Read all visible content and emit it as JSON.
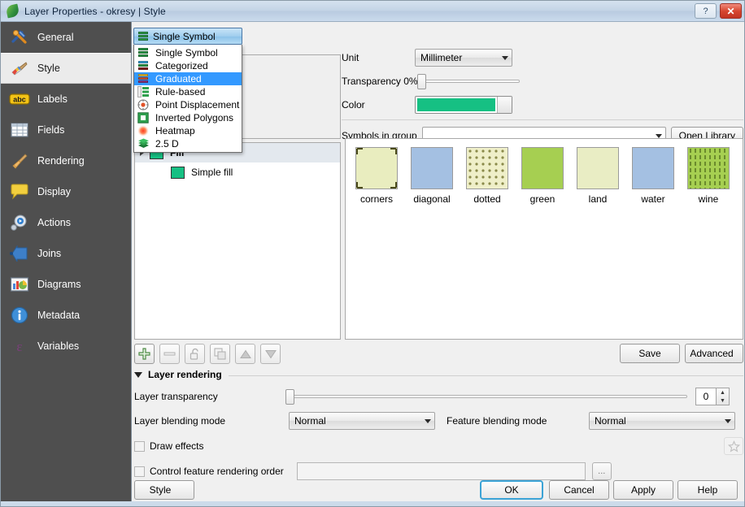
{
  "window": {
    "title": "Layer Properties - okresy | Style",
    "icon": "qgis-leaf-icon",
    "help_label": "?",
    "close_label": "✕"
  },
  "sidebar": {
    "items": [
      {
        "label": "General",
        "icon": "tools-icon",
        "selected": false
      },
      {
        "label": "Style",
        "icon": "paintbrush-icon",
        "selected": true
      },
      {
        "label": "Labels",
        "icon": "abc-label-icon",
        "selected": false
      },
      {
        "label": "Fields",
        "icon": "table-icon",
        "selected": false
      },
      {
        "label": "Rendering",
        "icon": "broom-icon",
        "selected": false
      },
      {
        "label": "Display",
        "icon": "speech-bubble-icon",
        "selected": false
      },
      {
        "label": "Actions",
        "icon": "gear-play-icon",
        "selected": false
      },
      {
        "label": "Joins",
        "icon": "join-arrow-icon",
        "selected": false
      },
      {
        "label": "Diagrams",
        "icon": "diagram-icon",
        "selected": false
      },
      {
        "label": "Metadata",
        "icon": "info-icon",
        "selected": false
      },
      {
        "label": "Variables",
        "icon": "epsilon-icon",
        "selected": false
      }
    ]
  },
  "renderer_dropdown": {
    "selected": "Single Symbol",
    "expanded": true,
    "options": [
      {
        "label": "Single Symbol",
        "icon": "single-symbol-icon",
        "highlighted": false
      },
      {
        "label": "Categorized",
        "icon": "categorized-icon",
        "highlighted": false
      },
      {
        "label": "Graduated",
        "icon": "graduated-icon",
        "highlighted": true
      },
      {
        "label": "Rule-based",
        "icon": "rule-based-icon",
        "highlighted": false
      },
      {
        "label": "Point Displacement",
        "icon": "point-displacement-icon",
        "highlighted": false
      },
      {
        "label": "Inverted Polygons",
        "icon": "inverted-polygons-icon",
        "highlighted": false
      },
      {
        "label": "Heatmap",
        "icon": "heatmap-icon",
        "highlighted": false
      },
      {
        "label": "2.5 D",
        "icon": "two-point-five-d-icon",
        "highlighted": false
      }
    ]
  },
  "symbol_preview": {
    "color": "#16c083"
  },
  "symbol_tree": {
    "parent": {
      "label": "Fill",
      "color": "#16c083",
      "selected": true
    },
    "child": {
      "label": "Simple fill",
      "color": "#16c083"
    }
  },
  "symbol_toolbar": {
    "buttons": [
      {
        "name": "add-symbol-layer",
        "icon": "plus-icon",
        "enabled": true
      },
      {
        "name": "remove-symbol-layer",
        "icon": "minus-icon",
        "enabled": false
      },
      {
        "name": "lock-symbol-layer",
        "icon": "lock-icon",
        "enabled": false
      },
      {
        "name": "duplicate-symbol-layer",
        "icon": "duplicate-icon",
        "enabled": false
      },
      {
        "name": "move-symbol-layer-up",
        "icon": "up-arrow-icon",
        "enabled": false
      },
      {
        "name": "move-symbol-layer-down",
        "icon": "down-arrow-icon",
        "enabled": false
      }
    ]
  },
  "symbol_properties": {
    "unit_label": "Unit",
    "unit_value": "Millimeter",
    "transparency_label": "Transparency 0%",
    "transparency_value": 0,
    "color_label": "Color",
    "color_value": "#16c083",
    "symbols_in_group_label": "Symbols in group",
    "symbols_in_group_value": "",
    "open_library_label": "Open Library"
  },
  "gallery": {
    "items": [
      {
        "label": "corners",
        "fill": "#e9edbf",
        "pattern": "corners"
      },
      {
        "label": "diagonal",
        "fill": "#a4c0e2",
        "pattern": "solid"
      },
      {
        "label": "dotted",
        "fill": "#efefc9",
        "pattern": "dots"
      },
      {
        "label": "green",
        "fill": "#a6cf51",
        "pattern": "solid"
      },
      {
        "label": "land",
        "fill": "#e9edc4",
        "pattern": "solid"
      },
      {
        "label": "water",
        "fill": "#a4c0e2",
        "pattern": "solid"
      },
      {
        "label": "wine",
        "fill": "#a6cf51",
        "pattern": "dashes"
      }
    ]
  },
  "style_actions": {
    "save_label": "Save",
    "advanced_label": "Advanced"
  },
  "layer_rendering": {
    "group_title": "Layer rendering",
    "transparency_label": "Layer transparency",
    "transparency_value": "0",
    "layer_blending_label": "Layer blending mode",
    "layer_blending_value": "Normal",
    "feature_blending_label": "Feature blending mode",
    "feature_blending_value": "Normal",
    "draw_effects_label": "Draw effects",
    "draw_effects_checked": false,
    "control_order_label": "Control feature rendering order",
    "control_order_checked": false,
    "control_order_value": "",
    "effects_button_icon": "star-icon",
    "order_button_label": "..."
  },
  "footer": {
    "style_label": "Style",
    "ok_label": "OK",
    "cancel_label": "Cancel",
    "apply_label": "Apply",
    "help_label": "Help"
  },
  "colors": {
    "accent_green": "#16c083",
    "highlight_blue": "#3399ff",
    "sidebar_bg": "#4f4f4f",
    "dialog_bg": "#f0f0f0"
  }
}
